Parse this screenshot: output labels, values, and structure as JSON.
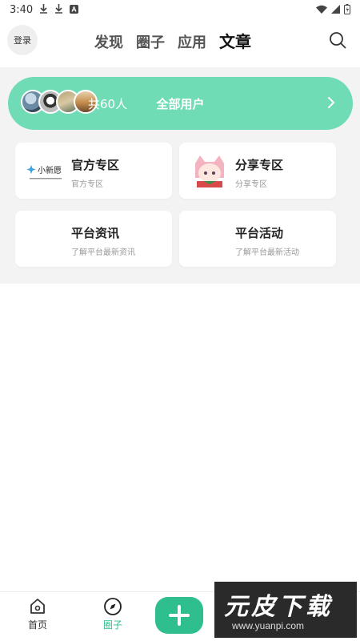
{
  "status_bar": {
    "time": "3:40",
    "icons": [
      "download-icon",
      "download-icon",
      "app-notification-icon",
      "wifi-icon",
      "signal-icon",
      "battery-icon"
    ]
  },
  "top_nav": {
    "login_label": "登录",
    "tabs": [
      {
        "label": "发现",
        "active": false
      },
      {
        "label": "圈子",
        "active": false
      },
      {
        "label": "应用",
        "active": false
      },
      {
        "label": "文章",
        "active": true
      }
    ],
    "search_icon": "search-icon"
  },
  "users_banner": {
    "count_text": "共60人",
    "all_users_label": "全部用户",
    "color": "#6fdcb6"
  },
  "cards": [
    {
      "title": "官方专区",
      "subtitle": "官方专区",
      "logo": "xiaoxinyuan-logo"
    },
    {
      "title": "分享专区",
      "subtitle": "分享专区",
      "logo": "anime-girl-avatar"
    },
    {
      "title": "平台资讯",
      "subtitle": "了解平台最新资讯",
      "logo": ""
    },
    {
      "title": "平台活动",
      "subtitle": "了解平台最新活动",
      "logo": ""
    }
  ],
  "logo_text": {
    "brand": "小新愿"
  },
  "bottom_nav": {
    "items": [
      {
        "label": "首页",
        "icon": "home-icon",
        "active": false
      },
      {
        "label": "圈子",
        "icon": "compass-icon",
        "active": true
      }
    ],
    "add_icon": "plus-icon",
    "accent": "#2fbf8f"
  },
  "watermark": {
    "logo": "元皮下载",
    "url": "www.yuanpi.com"
  }
}
